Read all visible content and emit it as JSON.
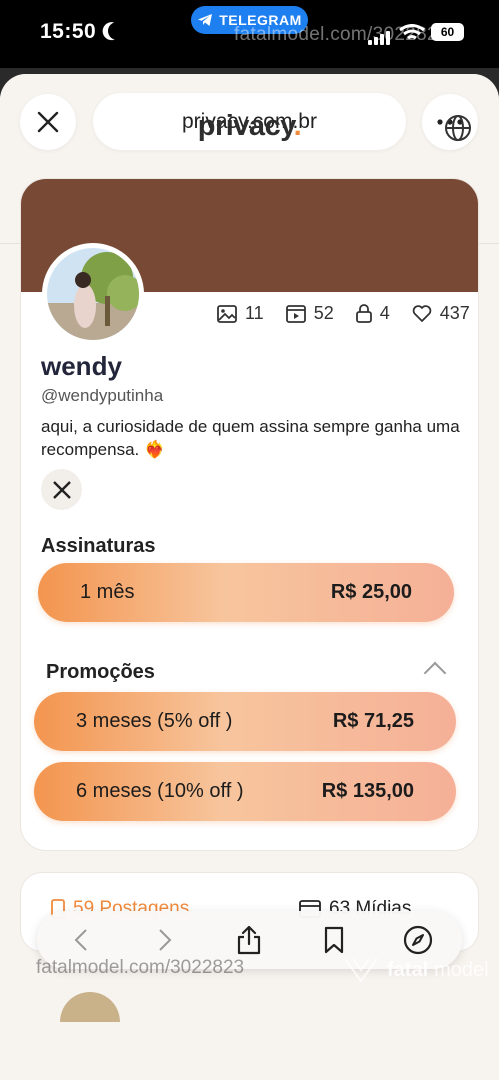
{
  "status_bar": {
    "time": "15:50",
    "telegram_label": "TELEGRAM",
    "watermark_top": "fatalmodel.com/3022823",
    "battery": "60"
  },
  "browser": {
    "url": "privacy.com.br"
  },
  "site": {
    "logo_text": "privacy",
    "logo_dot": ".",
    "accent_color": "#f08a3c",
    "banner_color": "#784a35"
  },
  "profile": {
    "name": "wendy",
    "handle": "@wendyputinha",
    "bio": "aqui, a curiosidade de quem assina sempre ganha uma recompensa. ❤️‍🔥",
    "stats": {
      "photos": "11",
      "videos": "52",
      "locked": "4",
      "likes": "437"
    }
  },
  "subscriptions": {
    "title": "Assinaturas",
    "plans": [
      {
        "label": "1 mês",
        "price": "R$ 25,00"
      }
    ]
  },
  "promotions": {
    "title": "Promoções",
    "plans": [
      {
        "label": "3 meses (5% off )",
        "price": "R$ 71,25"
      },
      {
        "label": "6 meses (10% off )",
        "price": "R$ 135,00"
      }
    ]
  },
  "tabs": {
    "posts": "59 Postagens",
    "media": "63 Mídias"
  },
  "watermark": {
    "bottom_text": "fatalmodel.com/3022823",
    "logo_bold": "fatal",
    "logo_light": "model"
  }
}
